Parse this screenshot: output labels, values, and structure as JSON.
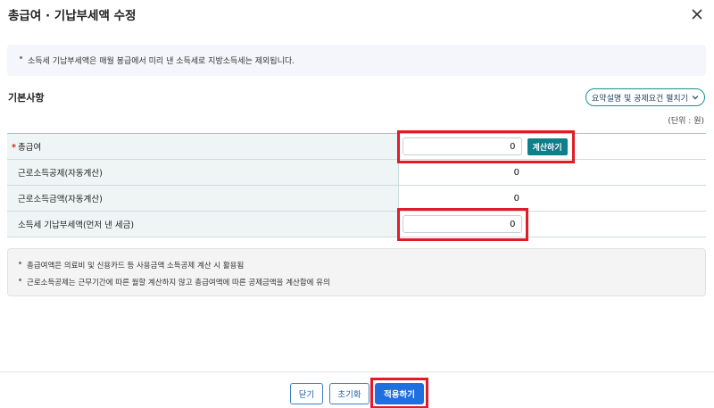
{
  "header": {
    "title": "총급여 · 기납부세액 수정"
  },
  "notice": {
    "text": "소득세 기납부세액은 매월 봉급에서 미리 낸 소득세로 지방소득세는 제외됩니다."
  },
  "section": {
    "title": "기본사항",
    "toggle_label": "요약설명 및 공제요건 펼치기",
    "unit": "(단위 : 원)"
  },
  "form": {
    "rows": [
      {
        "label": "총급여",
        "required_mark": "*",
        "value": "0",
        "button": "계산하기"
      },
      {
        "label": "근로소득공제(자동계산)",
        "value": "0"
      },
      {
        "label": "근로소득금액(자동계산)",
        "value": "0"
      },
      {
        "label": "소득세 기납부세액(먼저 낸 세금)",
        "value": "0"
      }
    ]
  },
  "info": {
    "lines": [
      "총급여액은 의료비 및 신용카드 등 사용금액 소득공제 계산 시 활용됨",
      "근로소득공제는 근무기간에 따른 월할 계산하지 않고 총급여액에 따른 공제금액을 계산함에 유의"
    ]
  },
  "footer": {
    "close_label": "닫기",
    "reset_label": "초기화",
    "apply_label": "적용하기"
  },
  "colors": {
    "accent_teal": "#0f7f8a",
    "primary_blue": "#1f6fe0",
    "highlight_red": "#e01b2a",
    "label_bg": "#eef5f4"
  }
}
